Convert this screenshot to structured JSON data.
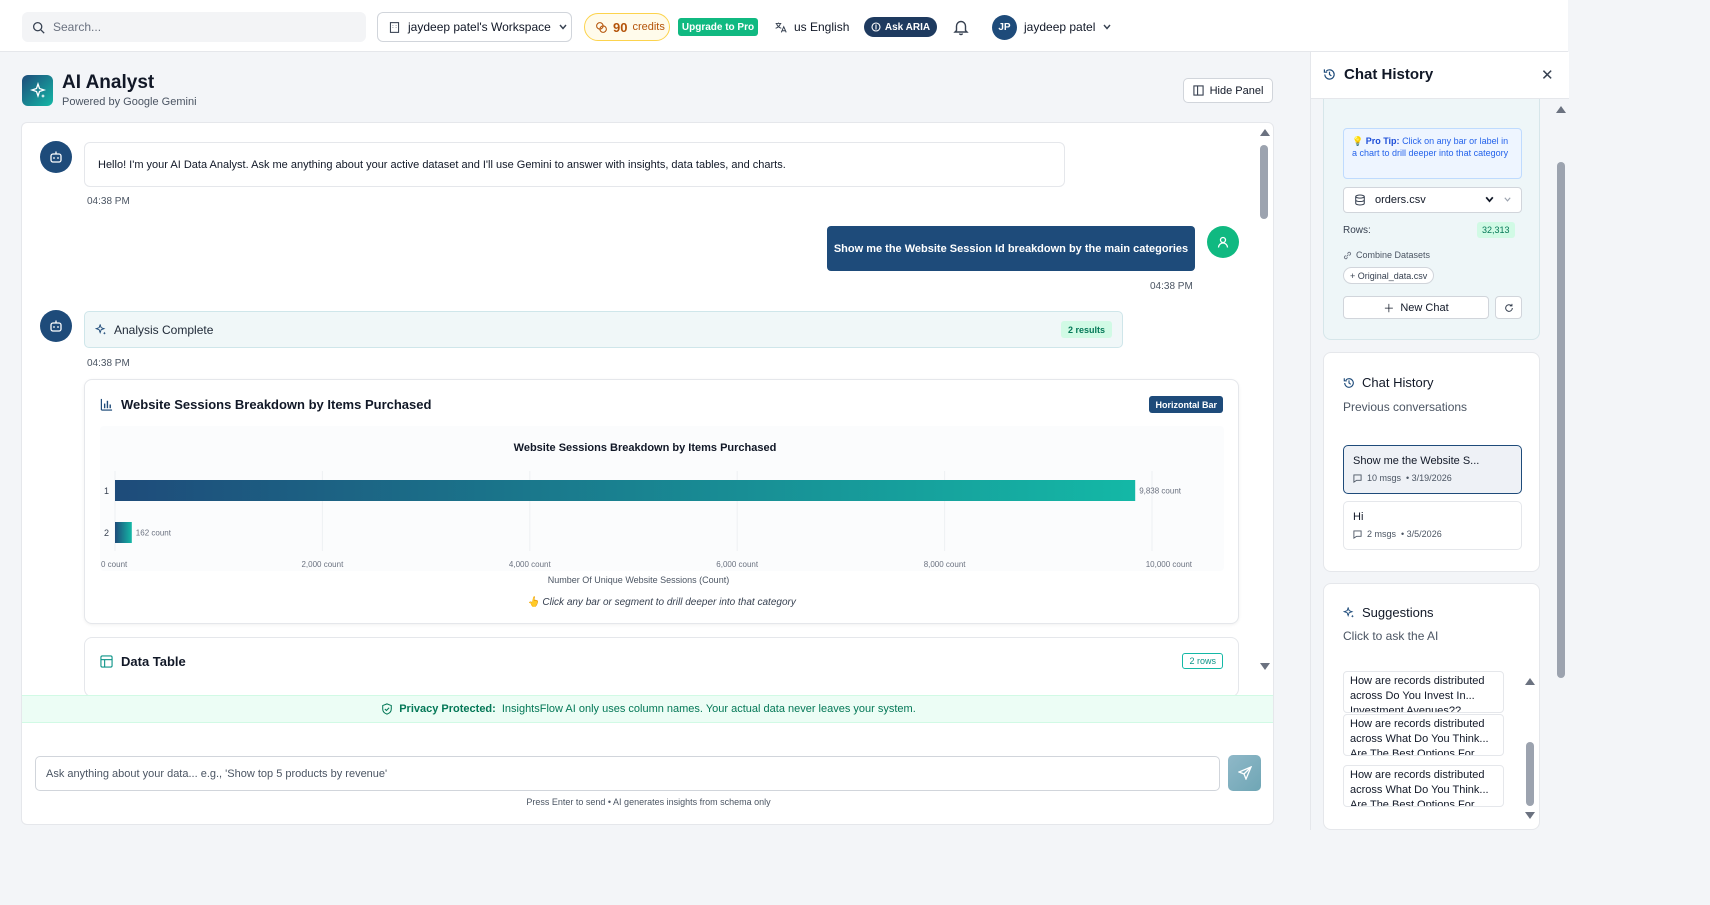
{
  "topbar": {
    "search_placeholder": "Search...",
    "workspace": "jaydeep patel's Workspace",
    "credits_value": "90",
    "credits_label": "credits",
    "upgrade": "Upgrade to Pro",
    "language": "us English",
    "ask_aria": "Ask ARIA",
    "user_initials": "JP",
    "user_name": "jaydeep patel"
  },
  "header": {
    "title": "AI Analyst",
    "subtitle": "Powered by Google Gemini",
    "hide_panel": "Hide Panel"
  },
  "chat": {
    "greeting": "Hello! I'm your AI Data Analyst. Ask me anything about your active dataset and I'll use Gemini to answer with insights, data tables, and charts.",
    "greeting_time": "04:38 PM",
    "user_message": "Show me the Website Session Id breakdown by the main categories",
    "user_time": "04:38 PM",
    "analysis_label": "Analysis Complete",
    "analysis_results": "2 results",
    "analysis_time": "04:38 PM",
    "chart_card_title": "Website Sessions Breakdown by Items Purchased",
    "chart_type_badge": "Horizontal Bar",
    "drill_hint": "👆 Click any bar or segment to drill deeper into that category",
    "table_title": "Data Table",
    "table_rows": "2 rows"
  },
  "chart_data": {
    "type": "bar",
    "orientation": "horizontal",
    "title": "Website Sessions Breakdown by Items Purchased",
    "categories": [
      "1",
      "2"
    ],
    "values": [
      9838,
      162
    ],
    "value_labels": [
      "9,838 count",
      "162 count"
    ],
    "xlabel": "Number Of Unique Website Sessions (Count)",
    "ylabel": "",
    "xlim": [
      0,
      10000
    ],
    "x_ticks": [
      0,
      2000,
      4000,
      6000,
      8000,
      10000
    ],
    "x_tick_labels": [
      "0 count",
      "2,000 count",
      "4,000 count",
      "6,000 count",
      "8,000 count",
      "10,000 count"
    ],
    "colors": {
      "start": "#1e4b7a",
      "end": "#14b8a6"
    },
    "grid": true
  },
  "footer": {
    "privacy_bold": "Privacy Protected:",
    "privacy_text": "InsightsFlow AI only uses column names. Your actual data never leaves your system.",
    "input_placeholder": "Ask anything about your data... e.g., 'Show top 5 products by revenue'",
    "enter_hint": "Press Enter to send • AI generates insights from schema only"
  },
  "panel": {
    "title": "Chat History",
    "tip_bold": "Pro Tip:",
    "tip_text": "Click on any bar or label in a chart to drill deeper into that category",
    "dataset": "orders.csv",
    "rows_label": "Rows:",
    "rows_value": "32,313",
    "combine_label": "Combine Datasets",
    "combine_chip": "+ Original_data.csv",
    "new_chat": "New Chat",
    "history_title": "Chat History",
    "history_sub": "Previous conversations",
    "history": [
      {
        "title": "Show me the Website S...",
        "msgs": "10 msgs",
        "date": "• 3/19/2026"
      },
      {
        "title": "Hi",
        "msgs": "2 msgs",
        "date": "• 3/5/2026"
      }
    ],
    "suggestions_title": "Suggestions",
    "suggestions_sub": "Click to ask the AI",
    "suggestions": [
      "How are records distributed across Do You Invest In... Investment Avenues??",
      "How are records distributed across What Do You Think... Are The Best Options For...",
      "How are records distributed across What Do You Think... Are The Best Options For..."
    ]
  }
}
